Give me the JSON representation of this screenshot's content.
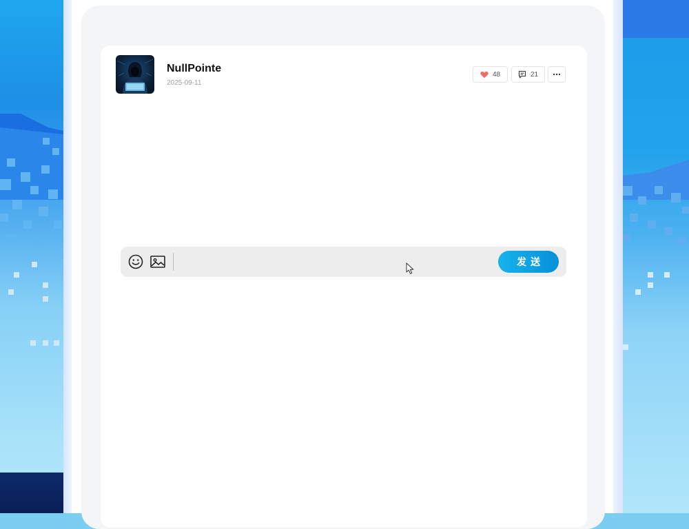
{
  "post": {
    "author": "NullPointe",
    "date": "2025-09-11",
    "likes": "48",
    "comments": "21"
  },
  "icons": {
    "like": "heart-icon",
    "comment": "comment-icon",
    "more": "more-dots-icon",
    "emoji": "smiley-icon",
    "image": "image-icon",
    "cursor": "mouse-pointer-icon"
  },
  "comment_bar": {
    "input_value": "",
    "input_placeholder": "",
    "send_label": "发送"
  },
  "colors": {
    "accent": "#0ea5e9",
    "heart": "#f06a6a"
  }
}
